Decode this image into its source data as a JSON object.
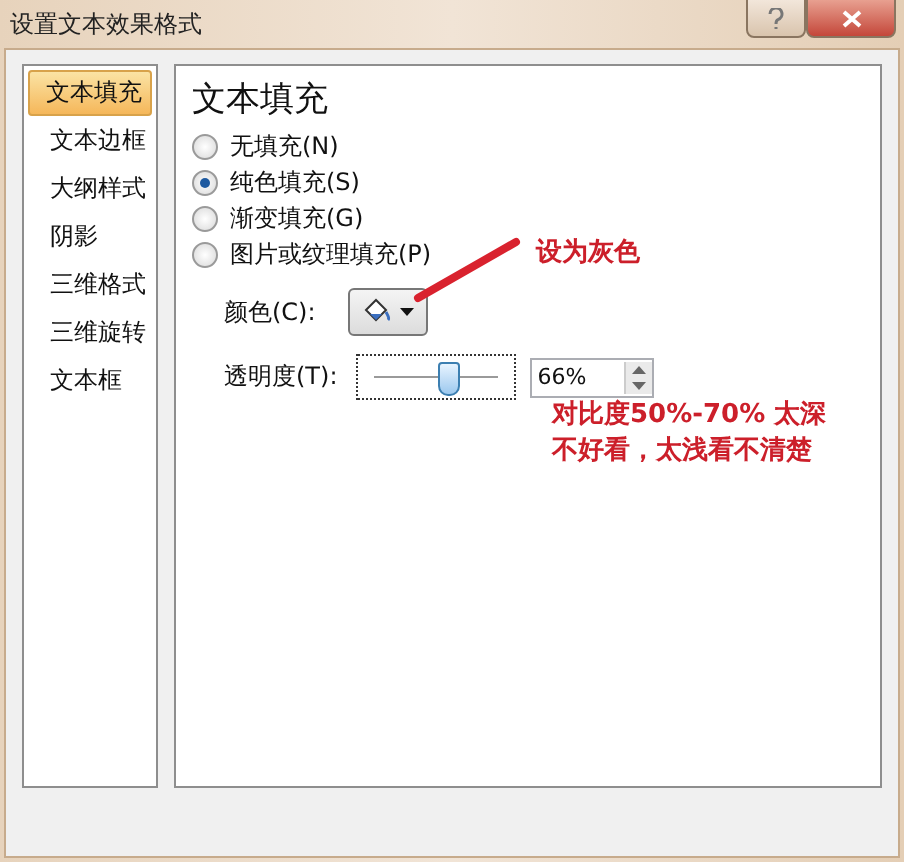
{
  "window": {
    "title": "设置文本效果格式"
  },
  "sidebar": {
    "items": [
      {
        "label": "文本填充",
        "selected": true
      },
      {
        "label": "文本边框",
        "selected": false
      },
      {
        "label": "大纲样式",
        "selected": false
      },
      {
        "label": "阴影",
        "selected": false
      },
      {
        "label": "三维格式",
        "selected": false
      },
      {
        "label": "三维旋转",
        "selected": false
      },
      {
        "label": "文本框",
        "selected": false
      }
    ]
  },
  "panel": {
    "title": "文本填充",
    "fill_options": [
      {
        "label": "无填充(N)",
        "selected": false
      },
      {
        "label": "纯色填充(S)",
        "selected": true
      },
      {
        "label": "渐变填充(G)",
        "selected": false
      },
      {
        "label": "图片或纹理填充(P)",
        "selected": false
      }
    ],
    "color": {
      "label": "颜色(C):"
    },
    "transparency": {
      "label": "透明度(T):",
      "level": 0.6,
      "value": "66%"
    }
  },
  "annotations": [
    {
      "text": "设为灰色"
    },
    {
      "text": "对比度50%-70%  太深不好看，太浅看不清楚"
    }
  ]
}
